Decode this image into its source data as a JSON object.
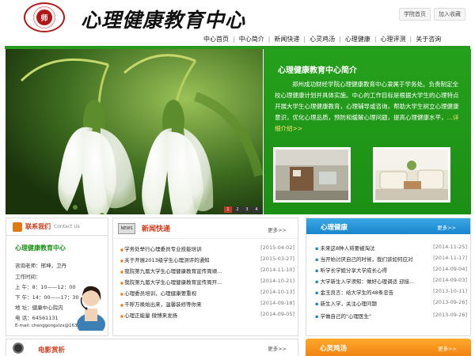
{
  "header": {
    "site_title": "心理健康教育中心",
    "logo_text": "师",
    "top_links": [
      "学院首页",
      "加入收藏"
    ]
  },
  "nav": {
    "items": [
      "中心首页",
      "中心简介",
      "新闻快递",
      "心灵鸡汤",
      "心理健康",
      "心理评测",
      "关于咨询"
    ]
  },
  "banner": {
    "pages": [
      "1",
      "2",
      "3",
      "4"
    ],
    "active_page": "1"
  },
  "intro": {
    "title": "心理健康教育中心简介",
    "text": "郑州成功财经学院心理健康教育中心隶属于学务处。负责制定全校心理健康计划并具体实施。中心的工作目标是根据大学生的心理特点开展大学生心理健康教育，心理辅导或咨询，帮助大学生树立心理健康意识，优化心理品质，预防和缓解心理问题，提高心理健康水平，",
    "more": "…详细介绍>>"
  },
  "contact": {
    "title": "联系我们",
    "title_en": "Contact Us",
    "name": "心理健康教育中心",
    "lines": [
      "咨询老师：邢坤，卫丹",
      "工作时间：",
      "上 午：8：10——12：00",
      "下 午：14：00——17：30",
      "地 址：健康中心院内",
      "电 话：64561131",
      "E-mail: chenggongxlzx@163.com"
    ]
  },
  "news": {
    "title": "新闻快递",
    "more": "更多>>",
    "items": [
      {
        "title": "学务处举行心理委员专业技能培训",
        "date": "[2015-04-02]"
      },
      {
        "title": "关于开展2013级学生心理测评的通知",
        "date": "[2015-03-27]"
      },
      {
        "title": "我院第九届大学生心理健康教育宣传周顺...",
        "date": "[2014-11-10]"
      },
      {
        "title": "我院第九届大学生心理健康教育宣传周开...",
        "date": "[2014-10-21]"
      },
      {
        "title": "心理委员培训，心理健康要重视",
        "date": "[2014-10-13]"
      },
      {
        "title": "千呼万唤始出来，温馨装修等你来",
        "date": "[2014-09-18]"
      },
      {
        "title": "心理正能量 微博来发扬",
        "date": "[2014-09-05]"
      }
    ]
  },
  "health": {
    "title": "心理健康",
    "more": "更多>>",
    "items": [
      {
        "title": "未来这8种人将要被淘汰",
        "date": "[2014-11-25]"
      },
      {
        "title": "当开始讨厌自己的时候，我们该如何应对",
        "date": "[2014-11-17]"
      },
      {
        "title": "听学长学姐分享大学成长心得",
        "date": "[2014-09-04]"
      },
      {
        "title": "大学新生入学须知：做好心理调适 迎接...",
        "date": "[2014-09-03]"
      },
      {
        "title": "金玉良言：给大学生的48条忠告",
        "date": "[2013-10-11]"
      },
      {
        "title": "新生入学，关注心理问题",
        "date": "[2013-09-26]"
      },
      {
        "title": "学做自己的\"心理医生\"",
        "date": "[2013-09-26]"
      }
    ]
  },
  "movies": {
    "title": "电影赏析",
    "more": "更多>>"
  },
  "soul": {
    "title": "心灵鸡汤",
    "more": "更多>>"
  },
  "colors": {
    "brand_green": "#1c8f15",
    "accent_red": "#d23b1c",
    "health_blue": "#1b86cc",
    "soul_orange": "#f08410"
  }
}
